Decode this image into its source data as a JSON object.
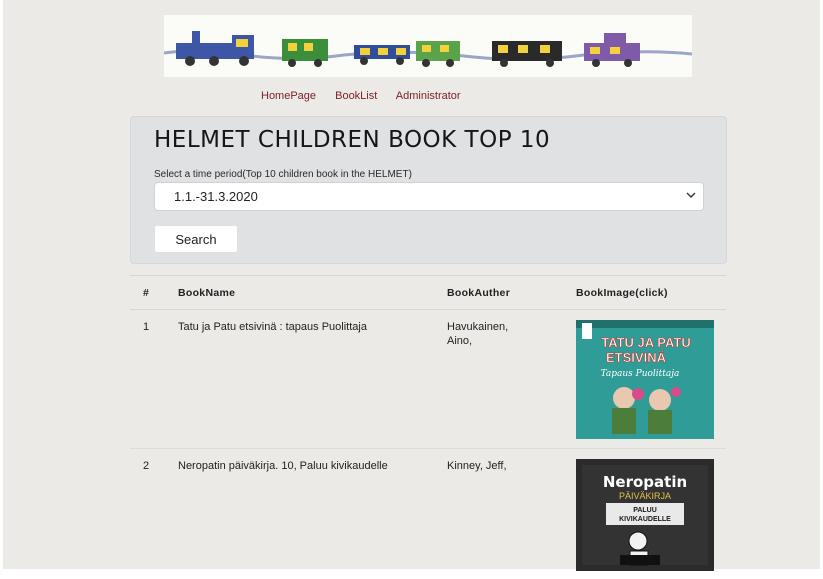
{
  "nav": {
    "links": [
      "HomePage",
      "BookList",
      "Administrator"
    ]
  },
  "main": {
    "title": "HELMET CHILDREN BOOK TOP 10",
    "select_label": "Select a time period(Top 10 children book in the HELMET)",
    "select_value": "1.1.-31.3.2020",
    "search_label": "Search"
  },
  "table": {
    "headers": [
      "#",
      "BookName",
      "BookAuther",
      "BookImage(click)"
    ],
    "rows": [
      {
        "rank": "1",
        "name": "Tatu ja Patu etsivinä : tapaus Puolittaja",
        "author": [
          "Havukainen,",
          "Aino,"
        ],
        "cover_text": [
          "TATU JA PATU",
          "ETSIVINÄ",
          "Tapaus Puolittaja"
        ]
      },
      {
        "rank": "2",
        "name": "Neropatin päiväkirja. 10, Paluu kivikaudelle",
        "author": [
          "Kinney, Jeff,"
        ],
        "cover_text": [
          "Neropatin",
          "PÄIVÄKIRJA",
          "PALUU",
          "KIVIKAUDELLE"
        ]
      }
    ]
  },
  "colors": {
    "nav_link": "#7b1f24",
    "panel_bg": "#e0e1e3",
    "page_bg": "#eceae6"
  }
}
